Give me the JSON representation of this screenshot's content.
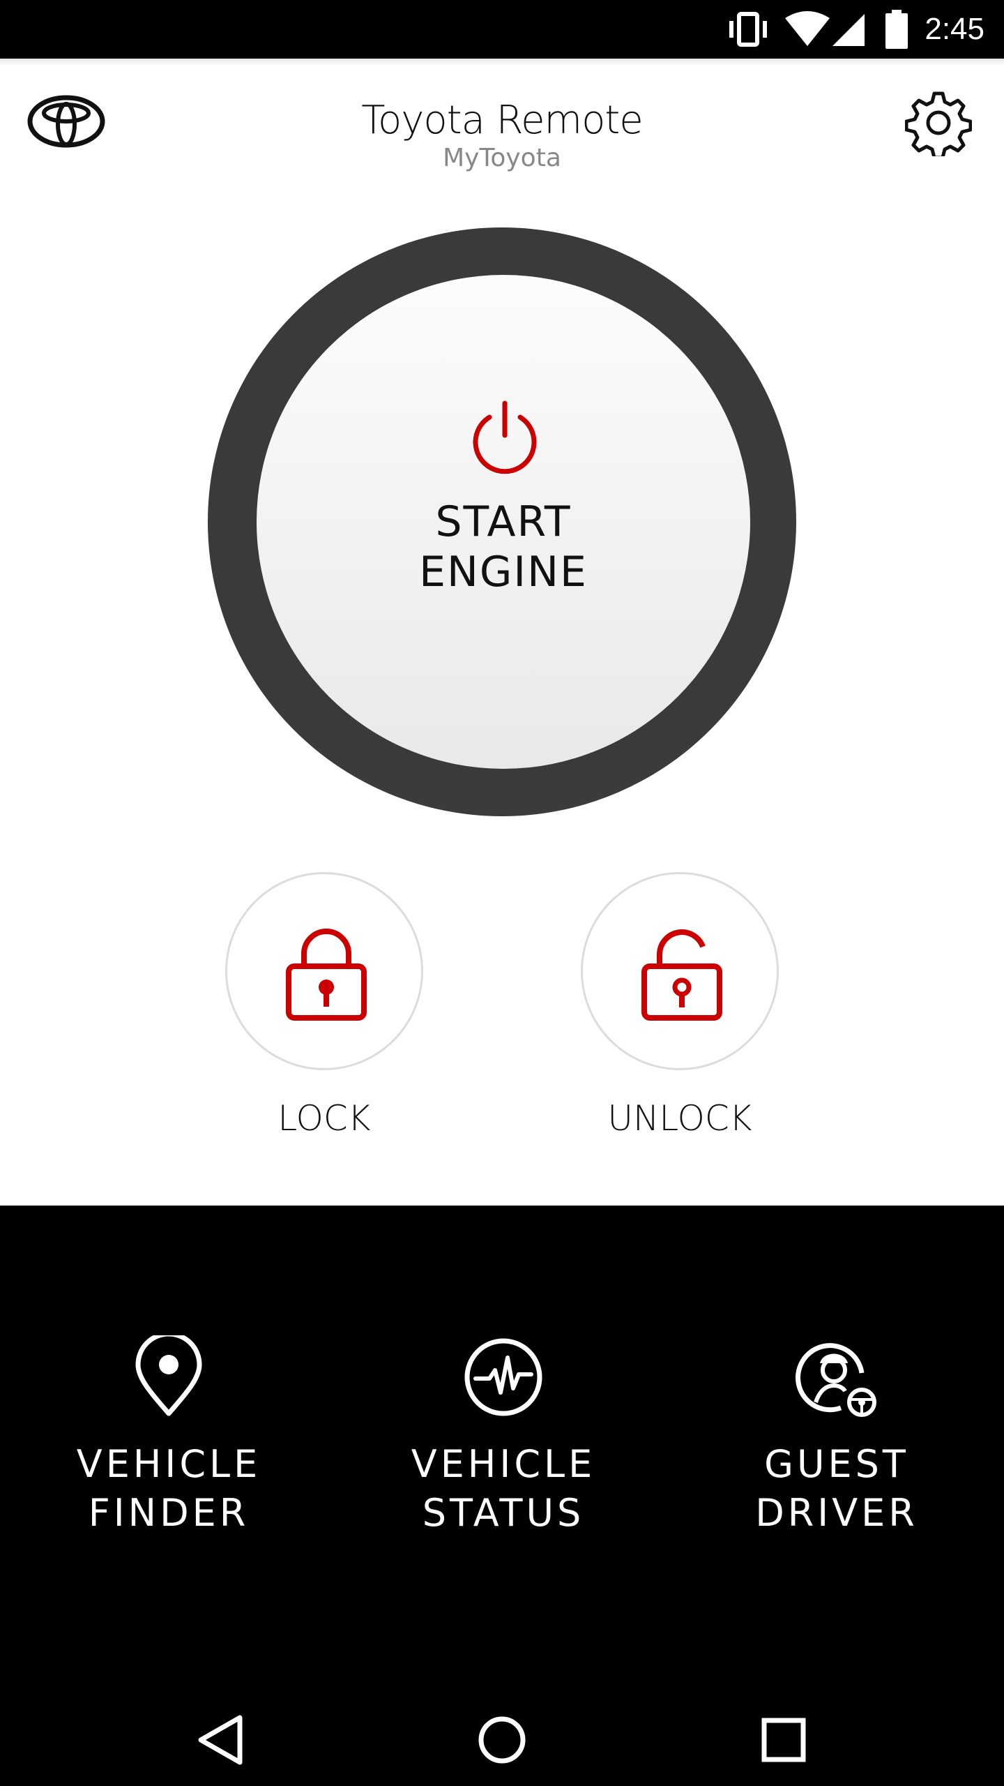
{
  "status_bar": {
    "time": "2:45",
    "icons": [
      "vibrate-icon",
      "wifi-icon",
      "cell-signal-icon",
      "battery-icon"
    ]
  },
  "header": {
    "title": "Toyota Remote",
    "subtitle": "MyToyota",
    "logo_icon": "toyota-logo",
    "settings_icon": "gear-icon"
  },
  "engine": {
    "line1": "START",
    "line2": "ENGINE",
    "icon": "power-icon",
    "accent": "#cc0000"
  },
  "lock": {
    "label": "LOCK",
    "icon": "lock-closed-icon"
  },
  "unlock": {
    "label": "UNLOCK",
    "icon": "lock-open-icon"
  },
  "features": [
    {
      "line1": "VEHICLE",
      "line2": "FINDER",
      "icon": "location-pin-icon"
    },
    {
      "line1": "VEHICLE",
      "line2": "STATUS",
      "icon": "pulse-icon"
    },
    {
      "line1": "GUEST",
      "line2": "DRIVER",
      "icon": "guest-driver-icon"
    }
  ],
  "nav": [
    "back-icon",
    "home-icon",
    "recents-icon"
  ]
}
